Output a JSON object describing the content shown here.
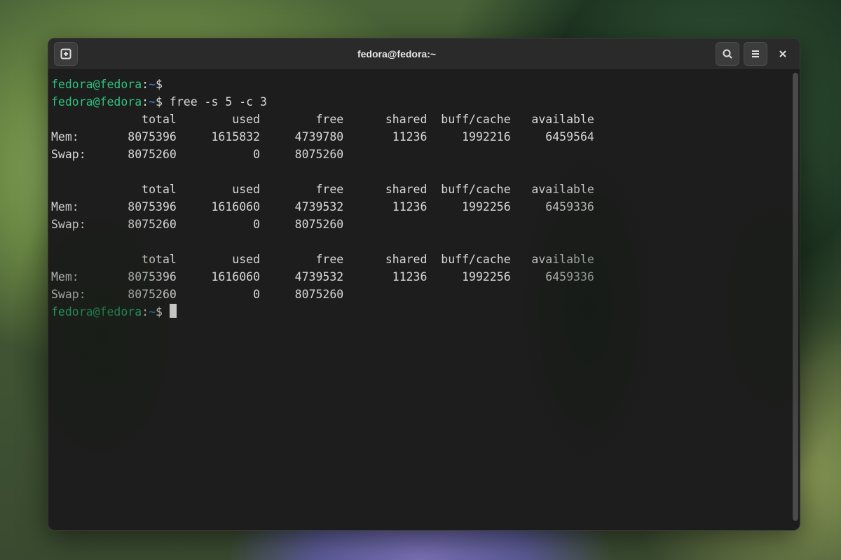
{
  "window": {
    "title": "fedora@fedora:~"
  },
  "prompt": {
    "user_host": "fedora@fedora",
    "sep": ":",
    "path": "~",
    "dollar": "$"
  },
  "commands": {
    "cmd0": "",
    "cmd1": "free -s 5 -c 3"
  },
  "columns": {
    "total": "total",
    "used": "used",
    "free": "free",
    "shared": "shared",
    "buff_cache": "buff/cache",
    "available": "available"
  },
  "row_labels": {
    "mem": "Mem:",
    "swap": "Swap:"
  },
  "samples": [
    {
      "mem": {
        "total": "8075396",
        "used": "1615832",
        "free": "4739780",
        "shared": "11236",
        "buff_cache": "1992216",
        "available": "6459564"
      },
      "swap": {
        "total": "8075260",
        "used": "0",
        "free": "8075260"
      }
    },
    {
      "mem": {
        "total": "8075396",
        "used": "1616060",
        "free": "4739532",
        "shared": "11236",
        "buff_cache": "1992256",
        "available": "6459336"
      },
      "swap": {
        "total": "8075260",
        "used": "0",
        "free": "8075260"
      }
    },
    {
      "mem": {
        "total": "8075396",
        "used": "1616060",
        "free": "4739532",
        "shared": "11236",
        "buff_cache": "1992256",
        "available": "6459336"
      },
      "swap": {
        "total": "8075260",
        "used": "0",
        "free": "8075260"
      }
    }
  ],
  "colors": {
    "prompt_user": "#2ec27e",
    "prompt_path": "#3584e4",
    "terminal_bg": "#1d1d1d",
    "terminal_fg": "#d8d8d8",
    "titlebar_bg": "#2a2a2a"
  }
}
